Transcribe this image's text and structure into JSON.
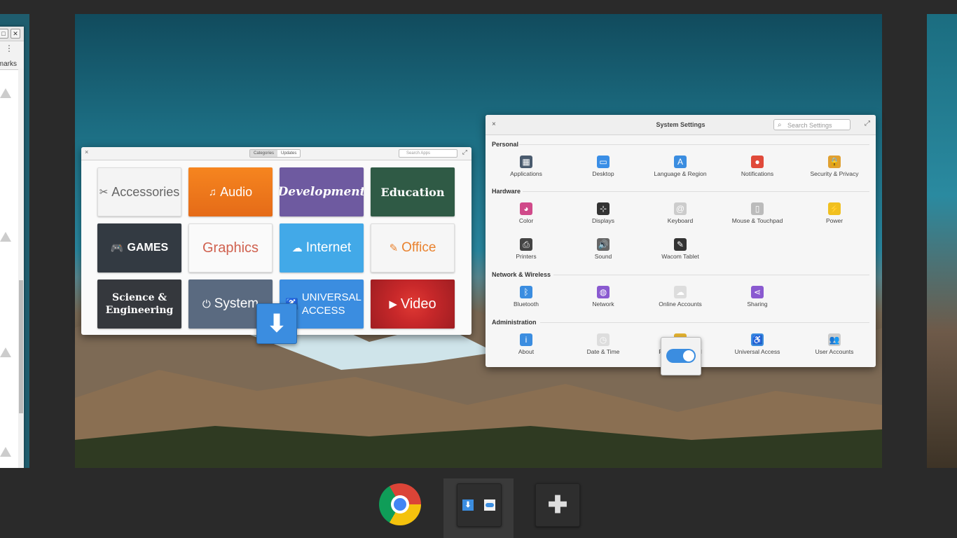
{
  "left_window": {
    "bookmarks_fragment": "marks",
    "menu_glyph": "⋮",
    "restore_glyph": "□",
    "close_glyph": "✕"
  },
  "app_center": {
    "close_glyph": "×",
    "tabs": [
      "Categories",
      "Updates"
    ],
    "active_tab": "Categories",
    "search_placeholder": "Search Apps",
    "maximize_glyph": "⤢",
    "categories": [
      {
        "label": "Accessories",
        "icon": "accessories-icon",
        "glyph": "✂"
      },
      {
        "label": "Audio",
        "icon": "music-note-icon",
        "glyph": "♫"
      },
      {
        "label": "Development",
        "icon": "",
        "glyph": ""
      },
      {
        "label": "Education",
        "icon": "",
        "glyph": ""
      },
      {
        "label": "GAMES",
        "icon": "gamepad-icon",
        "glyph": "🎮"
      },
      {
        "label": "Graphics",
        "icon": "",
        "glyph": ""
      },
      {
        "label": "Internet",
        "icon": "cloud-icon",
        "glyph": "☁"
      },
      {
        "label": "Office",
        "icon": "pencil-icon",
        "glyph": "✎"
      },
      {
        "label": "Science & Engineering",
        "icon": "",
        "glyph": ""
      },
      {
        "label": "System",
        "icon": "power-icon",
        "glyph": "⏻"
      },
      {
        "label": "UNIVERSAL ACCESS",
        "icon": "accessibility-icon",
        "glyph": "♿"
      },
      {
        "label": "Video",
        "icon": "play-icon",
        "glyph": "▶"
      }
    ]
  },
  "dragged_download_icon": {
    "glyph": "⬇",
    "icon": "download-arrow-icon"
  },
  "system_settings": {
    "title": "System Settings",
    "search_placeholder": "Search Settings",
    "close_glyph": "×",
    "maximize_glyph": "⤢",
    "sections": [
      {
        "title": "Personal",
        "items": [
          {
            "label": "Applications",
            "icon": "applications-icon",
            "color": "#4a5b6e",
            "glyph": "▦"
          },
          {
            "label": "Desktop",
            "icon": "desktop-icon",
            "color": "#3a8ee6",
            "glyph": "▭"
          },
          {
            "label": "Language & Region",
            "icon": "language-icon",
            "color": "#3b8de0",
            "glyph": "A"
          },
          {
            "label": "Notifications",
            "icon": "notifications-icon",
            "color": "#e04a3a",
            "glyph": "●"
          },
          {
            "label": "Security & Privacy",
            "icon": "lock-icon",
            "color": "#e0a030",
            "glyph": "🔒"
          }
        ]
      },
      {
        "title": "Hardware",
        "items": [
          {
            "label": "Color",
            "icon": "color-icon",
            "color": "#d04a8a",
            "glyph": "◕"
          },
          {
            "label": "Displays",
            "icon": "displays-icon",
            "color": "#333333",
            "glyph": "⊹"
          },
          {
            "label": "Keyboard",
            "icon": "keyboard-icon",
            "color": "#cccccc",
            "glyph": "@"
          },
          {
            "label": "Mouse & Touchpad",
            "icon": "mouse-icon",
            "color": "#bbbbbb",
            "glyph": "▯"
          },
          {
            "label": "Power",
            "icon": "power-bolt-icon",
            "color": "#f0c020",
            "glyph": "⚡"
          },
          {
            "label": "Printers",
            "icon": "printer-icon",
            "color": "#444444",
            "glyph": "⎙"
          },
          {
            "label": "Sound",
            "icon": "speaker-icon",
            "color": "#666666",
            "glyph": "🔊"
          },
          {
            "label": "Wacom Tablet",
            "icon": "tablet-icon",
            "color": "#333333",
            "glyph": "✎"
          }
        ]
      },
      {
        "title": "Network & Wireless",
        "items": [
          {
            "label": "Bluetooth",
            "icon": "bluetooth-icon",
            "color": "#3b8de0",
            "glyph": "ᛒ"
          },
          {
            "label": "Network",
            "icon": "network-icon",
            "color": "#8a5ad0",
            "glyph": "◍"
          },
          {
            "label": "Online Accounts",
            "icon": "cloud-icon",
            "color": "#dddddd",
            "glyph": "☁"
          },
          {
            "label": "Sharing",
            "icon": "share-icon",
            "color": "#8a5ad0",
            "glyph": "⋖"
          }
        ]
      },
      {
        "title": "Administration",
        "items": [
          {
            "label": "About",
            "icon": "info-icon",
            "color": "#3b8de0",
            "glyph": "i"
          },
          {
            "label": "Date & Time",
            "icon": "clock-icon",
            "color": "#dddddd",
            "glyph": "◷"
          },
          {
            "label": "Parental Control",
            "icon": "parental-control-icon",
            "color": "#e0b030",
            "glyph": "☺"
          },
          {
            "label": "Universal Access",
            "icon": "universal-access-icon",
            "color": "#3b8de0",
            "glyph": "♿"
          },
          {
            "label": "User Accounts",
            "icon": "user-accounts-icon",
            "color": "#cccccc",
            "glyph": "👥"
          }
        ]
      }
    ]
  },
  "dock": {
    "add_workspace_glyph": "✚"
  }
}
